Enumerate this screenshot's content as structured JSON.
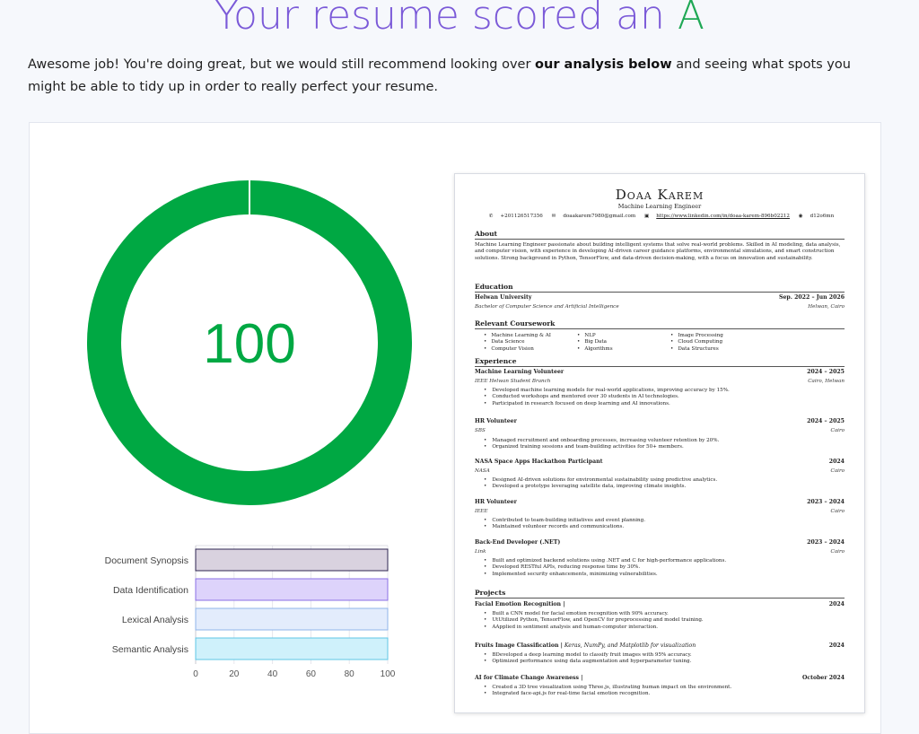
{
  "headline": {
    "prefix": "Your resume scored an",
    "grade": "A"
  },
  "intro": {
    "before": "Awesome job! You're doing great, but we would still recommend looking over ",
    "bold": "our analysis below",
    "after": " and seeing what spots you might be able to tidy up in order to really perfect your resume."
  },
  "score": {
    "value": 100,
    "max": 100,
    "color": "#00a843"
  },
  "chart_data": {
    "type": "bar",
    "orientation": "horizontal",
    "categories": [
      "Document Synopsis",
      "Data Identification",
      "Lexical Analysis",
      "Semantic Analysis"
    ],
    "values": [
      100,
      100,
      100,
      100
    ],
    "xlim": [
      0,
      100
    ],
    "xticks": [
      0,
      20,
      40,
      60,
      80,
      100
    ],
    "grid": true,
    "fills": [
      "#d9d2df",
      "#ddd3fb",
      "#e3ecfc",
      "#cff1fb"
    ],
    "strokes": [
      "#2d2450",
      "#8a6fe6",
      "#8fb4ea",
      "#5fc6e6"
    ]
  },
  "resume": {
    "name": "Doaa Karem",
    "role": "Machine Learning Engineer",
    "contacts": [
      "+201126517356",
      "doaakarem7980@gmail.com",
      "https://www.linkedin.com/in/doaa-karem-896b02212",
      "d12o6mn"
    ],
    "sections": {
      "about": "About",
      "education": "Education",
      "coursework": "Relevant Coursework",
      "experience": "Experience",
      "projects": "Projects"
    },
    "about": "Machine Learning Engineer passionate about building intelligent systems that solve real-world problems. Skilled in AI modeling, data analysis, and computer vision, with experience in developing AI-driven career guidance platforms, environmental simulations, and smart construction solutions. Strong background in Python, TensorFlow, and data-driven decision-making, with a focus on innovation and sustainability.",
    "education": {
      "school": "Helwan University",
      "dates": "Sep. 2022 – Jun 2026",
      "degree": "Bachelor of Computer Science and Artificial Intelligence",
      "location": "Helwan, Cairo"
    },
    "coursework": [
      [
        "Machine Learning & AI",
        "Data Science",
        "Computer Vision"
      ],
      [
        "NLP",
        "Big Data",
        "Algorithms"
      ],
      [
        "Image Processing",
        "Cloud Computing",
        "Data Structures"
      ]
    ],
    "experience": [
      {
        "title": "Machine Learning Volunteer",
        "dates": "2024 – 2025",
        "org": "IEEE Helwan Student Branch",
        "loc": "Cairo, Helwan",
        "bullets": [
          "Developed machine learning models for real-world applications, improving accuracy by 15%.",
          "Conducted workshops and mentored over 30 students in AI technologies.",
          "Participated in research focused on deep learning and AI innovations."
        ]
      },
      {
        "title": "HR Volunteer",
        "dates": "2024 – 2025",
        "org": "SBS",
        "loc": "Cairo",
        "bullets": [
          "Managed recruitment and onboarding processes, increasing volunteer retention by 20%.",
          "Organized training sessions and team-building activities for 50+ members."
        ]
      },
      {
        "title": "NASA Space Apps Hackathon Participant",
        "dates": "2024",
        "org": "NASA",
        "loc": "Cairo",
        "bullets": [
          "Designed AI-driven solutions for environmental sustainability using predictive analytics.",
          "Developed a prototype leveraging satellite data, improving climate insights."
        ]
      },
      {
        "title": "HR Volunteer",
        "dates": "2023 – 2024",
        "org": "IEEE",
        "loc": "Cairo",
        "bullets": [
          "Contributed to team-building initiatives and event planning.",
          "Maintained volunteer records and communications."
        ]
      },
      {
        "title": "Back-End Developer (.NET)",
        "dates": "2023 – 2024",
        "org": "Link",
        "loc": "Cairo",
        "bullets": [
          "Built and optimized backend solutions using .NET and C for high-performance applications.",
          "Developed RESTful APIs, reducing response time by 30%.",
          "Implemented security enhancements, minimizing vulnerabilities."
        ]
      }
    ],
    "projects": [
      {
        "title": "Facial Emotion Recognition |",
        "tech": "",
        "date": "2024",
        "bullets": [
          "Built a CNN model for facial emotion recognition with 90% accuracy.",
          "UtUtilized Python, TensorFlow, and OpenCV for preprocessing and model training.",
          "AApplied in sentiment analysis and human-computer interaction."
        ]
      },
      {
        "title": "Fruits Image Classification |",
        "tech": " Keras, NumPy, and Matplotlib for visualization",
        "date": "2024",
        "bullets": [
          "BDeveloped a deep learning model to classify fruit images with 95% accuracy.",
          "Optimized performance using data augmentation and hyperparameter tuning."
        ]
      },
      {
        "title": "AI for Climate Change Awareness |",
        "tech": "",
        "date": "October 2024",
        "bullets": [
          "Created a 3D tree visualization using Three.js, illustrating human impact on the environment.",
          "Integrated face-api.js for real-time facial emotion recognition."
        ]
      }
    ]
  }
}
